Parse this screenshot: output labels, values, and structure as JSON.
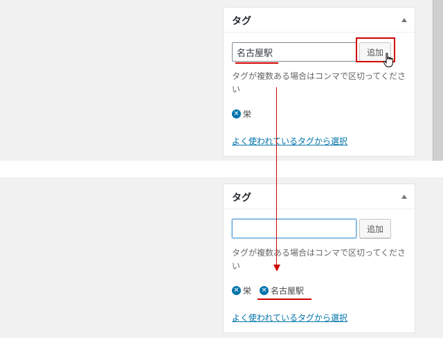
{
  "before": {
    "panel_title": "タグ",
    "input_value": "名古屋駅",
    "add_button_label": "追加",
    "help_text": "タグが複数ある場合はコンマで区切ってください",
    "tags": [
      "栄"
    ],
    "popular_link": "よく使われているタグから選択"
  },
  "after": {
    "panel_title": "タグ",
    "input_value": "",
    "add_button_label": "追加",
    "help_text": "タグが複数ある場合はコンマで区切ってください",
    "tags": [
      "栄",
      "名古屋駅"
    ],
    "popular_link": "よく使われているタグから選択"
  },
  "icons": {
    "remove": "remove-tag-icon",
    "toggle": "triangle-up-icon",
    "cursor": "hand-pointer-icon"
  },
  "colors": {
    "accent_link": "#0073aa",
    "annotation_red": "#d00000",
    "panel_bg": "#ffffff",
    "page_bg": "#f1f1f1"
  }
}
